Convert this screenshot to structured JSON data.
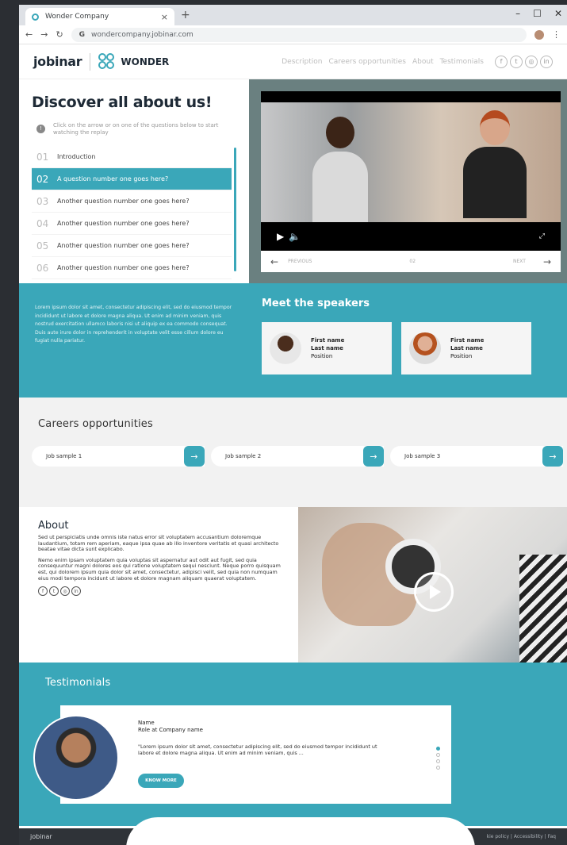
{
  "browser": {
    "tab_title": "Wonder Company",
    "url": "wondercompany.jobinar.com",
    "controls": [
      "–",
      "☐",
      "✕"
    ]
  },
  "header": {
    "brand": "jobinar",
    "partner": "WONDER",
    "nav": [
      "Description",
      "Careers opportunities",
      "About",
      "Testimonials"
    ],
    "social": [
      "f",
      "t",
      "◎",
      "in"
    ]
  },
  "hero": {
    "title": "Discover all about us!",
    "hint": "Click on the arrow or on one of the questions below to start watching the replay",
    "questions": [
      {
        "num": "01",
        "label": "Introduction"
      },
      {
        "num": "02",
        "label": "A question number one goes here?"
      },
      {
        "num": "03",
        "label": "Another question number one goes here?"
      },
      {
        "num": "04",
        "label": "Another question number one goes here?"
      },
      {
        "num": "05",
        "label": "Another question number one goes here?"
      },
      {
        "num": "06",
        "label": "Another question number one goes here?"
      }
    ],
    "video": {
      "prev": "PREVIOUS",
      "current": "02",
      "next": "NEXT"
    }
  },
  "speakers": {
    "intro": "Lorem ipsum dolor sit amet, consectetur adipiscing elit, sed do eiusmod tempor incididunt ut labore et dolore magna aliqua. Ut enim ad minim veniam, quis nostrud exercitation ullamco laboris nisi ut aliquip ex ea commodo consequat. Duis aute irure dolor in reprehenderit in voluptate velit esse cillum dolore eu fugiat nulla pariatur.",
    "title": "Meet the speakers",
    "list": [
      {
        "first": "First name",
        "last": "Last name",
        "position": "Position"
      },
      {
        "first": "First name",
        "last": "Last name",
        "position": "Position"
      }
    ]
  },
  "careers": {
    "title": "Careers opportunities",
    "jobs": [
      "Job sample 1",
      "Job sample 2",
      "Job sample 3"
    ]
  },
  "about": {
    "title": "About",
    "p1": "Sed ut perspiciatis unde omnis iste natus error sit voluptatem accusantium doloremque laudantium, totam rem aperiam, eaque ipsa quae ab illo inventore veritatis et quasi architecto beatae vitae dicta sunt explicabo.",
    "p2": "Nemo enim ipsam voluptatem quia voluptas sit aspernatur aut odit aut fugit, sed quia consequuntur magni dolores eos qui ratione voluptatem sequi nesciunt. Neque porro quisquam est, qui dolorem ipsum quia dolor sit amet, consectetur, adipisci velit, sed quia non numquam eius modi tempora incidunt ut labore et dolore magnam aliquam quaerat voluptatem."
  },
  "testimonials": {
    "title": "Testimonials",
    "name": "Name",
    "role": "Role at Company name",
    "quote": "\"Lorem ipsum dolor sit amet, consectetur adipiscing elit, sed do eiusmod tempor incididunt ut labore et dolore magna aliqua. Ut enim ad minim veniam, quis ...",
    "button": "KNOW MORE"
  },
  "footer": {
    "brand": "jobinar",
    "links": "kie policy | Accessibility | Faq"
  },
  "colors": {
    "accent": "#3aa7b9",
    "dark": "#1e2a36"
  }
}
